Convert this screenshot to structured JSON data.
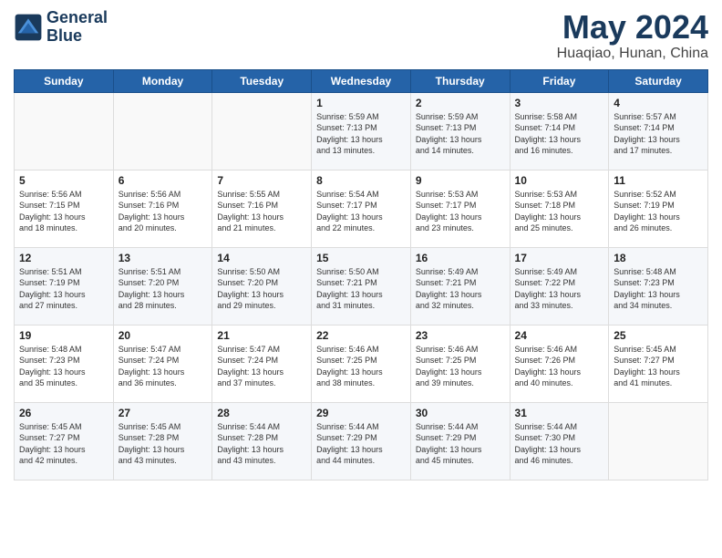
{
  "header": {
    "logo_line1": "General",
    "logo_line2": "Blue",
    "month_year": "May 2024",
    "location": "Huaqiao, Hunan, China"
  },
  "weekdays": [
    "Sunday",
    "Monday",
    "Tuesday",
    "Wednesday",
    "Thursday",
    "Friday",
    "Saturday"
  ],
  "weeks": [
    [
      {
        "day": "",
        "info": ""
      },
      {
        "day": "",
        "info": ""
      },
      {
        "day": "",
        "info": ""
      },
      {
        "day": "1",
        "info": "Sunrise: 5:59 AM\nSunset: 7:13 PM\nDaylight: 13 hours\nand 13 minutes."
      },
      {
        "day": "2",
        "info": "Sunrise: 5:59 AM\nSunset: 7:13 PM\nDaylight: 13 hours\nand 14 minutes."
      },
      {
        "day": "3",
        "info": "Sunrise: 5:58 AM\nSunset: 7:14 PM\nDaylight: 13 hours\nand 16 minutes."
      },
      {
        "day": "4",
        "info": "Sunrise: 5:57 AM\nSunset: 7:14 PM\nDaylight: 13 hours\nand 17 minutes."
      }
    ],
    [
      {
        "day": "5",
        "info": "Sunrise: 5:56 AM\nSunset: 7:15 PM\nDaylight: 13 hours\nand 18 minutes."
      },
      {
        "day": "6",
        "info": "Sunrise: 5:56 AM\nSunset: 7:16 PM\nDaylight: 13 hours\nand 20 minutes."
      },
      {
        "day": "7",
        "info": "Sunrise: 5:55 AM\nSunset: 7:16 PM\nDaylight: 13 hours\nand 21 minutes."
      },
      {
        "day": "8",
        "info": "Sunrise: 5:54 AM\nSunset: 7:17 PM\nDaylight: 13 hours\nand 22 minutes."
      },
      {
        "day": "9",
        "info": "Sunrise: 5:53 AM\nSunset: 7:17 PM\nDaylight: 13 hours\nand 23 minutes."
      },
      {
        "day": "10",
        "info": "Sunrise: 5:53 AM\nSunset: 7:18 PM\nDaylight: 13 hours\nand 25 minutes."
      },
      {
        "day": "11",
        "info": "Sunrise: 5:52 AM\nSunset: 7:19 PM\nDaylight: 13 hours\nand 26 minutes."
      }
    ],
    [
      {
        "day": "12",
        "info": "Sunrise: 5:51 AM\nSunset: 7:19 PM\nDaylight: 13 hours\nand 27 minutes."
      },
      {
        "day": "13",
        "info": "Sunrise: 5:51 AM\nSunset: 7:20 PM\nDaylight: 13 hours\nand 28 minutes."
      },
      {
        "day": "14",
        "info": "Sunrise: 5:50 AM\nSunset: 7:20 PM\nDaylight: 13 hours\nand 29 minutes."
      },
      {
        "day": "15",
        "info": "Sunrise: 5:50 AM\nSunset: 7:21 PM\nDaylight: 13 hours\nand 31 minutes."
      },
      {
        "day": "16",
        "info": "Sunrise: 5:49 AM\nSunset: 7:21 PM\nDaylight: 13 hours\nand 32 minutes."
      },
      {
        "day": "17",
        "info": "Sunrise: 5:49 AM\nSunset: 7:22 PM\nDaylight: 13 hours\nand 33 minutes."
      },
      {
        "day": "18",
        "info": "Sunrise: 5:48 AM\nSunset: 7:23 PM\nDaylight: 13 hours\nand 34 minutes."
      }
    ],
    [
      {
        "day": "19",
        "info": "Sunrise: 5:48 AM\nSunset: 7:23 PM\nDaylight: 13 hours\nand 35 minutes."
      },
      {
        "day": "20",
        "info": "Sunrise: 5:47 AM\nSunset: 7:24 PM\nDaylight: 13 hours\nand 36 minutes."
      },
      {
        "day": "21",
        "info": "Sunrise: 5:47 AM\nSunset: 7:24 PM\nDaylight: 13 hours\nand 37 minutes."
      },
      {
        "day": "22",
        "info": "Sunrise: 5:46 AM\nSunset: 7:25 PM\nDaylight: 13 hours\nand 38 minutes."
      },
      {
        "day": "23",
        "info": "Sunrise: 5:46 AM\nSunset: 7:25 PM\nDaylight: 13 hours\nand 39 minutes."
      },
      {
        "day": "24",
        "info": "Sunrise: 5:46 AM\nSunset: 7:26 PM\nDaylight: 13 hours\nand 40 minutes."
      },
      {
        "day": "25",
        "info": "Sunrise: 5:45 AM\nSunset: 7:27 PM\nDaylight: 13 hours\nand 41 minutes."
      }
    ],
    [
      {
        "day": "26",
        "info": "Sunrise: 5:45 AM\nSunset: 7:27 PM\nDaylight: 13 hours\nand 42 minutes."
      },
      {
        "day": "27",
        "info": "Sunrise: 5:45 AM\nSunset: 7:28 PM\nDaylight: 13 hours\nand 43 minutes."
      },
      {
        "day": "28",
        "info": "Sunrise: 5:44 AM\nSunset: 7:28 PM\nDaylight: 13 hours\nand 43 minutes."
      },
      {
        "day": "29",
        "info": "Sunrise: 5:44 AM\nSunset: 7:29 PM\nDaylight: 13 hours\nand 44 minutes."
      },
      {
        "day": "30",
        "info": "Sunrise: 5:44 AM\nSunset: 7:29 PM\nDaylight: 13 hours\nand 45 minutes."
      },
      {
        "day": "31",
        "info": "Sunrise: 5:44 AM\nSunset: 7:30 PM\nDaylight: 13 hours\nand 46 minutes."
      },
      {
        "day": "",
        "info": ""
      }
    ]
  ]
}
